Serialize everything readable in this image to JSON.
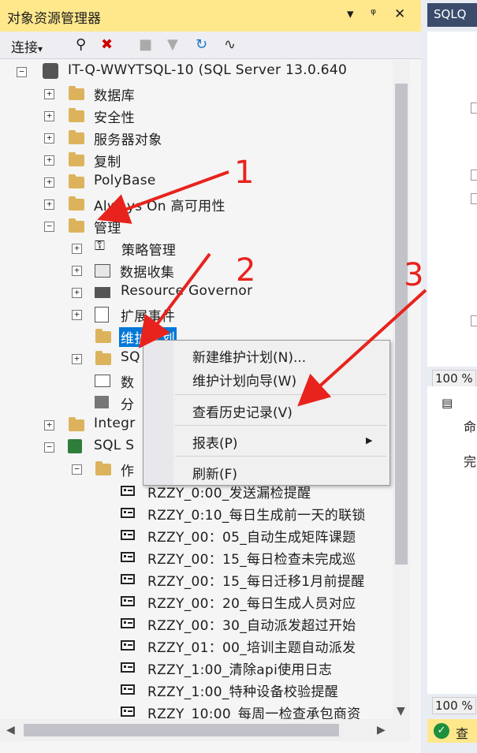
{
  "panel": {
    "title": "对象资源管理器",
    "pin": "▾",
    "dock": "⊓",
    "close": "✕"
  },
  "toolbar": {
    "connect_label": "连接",
    "connect_arrow": "▾"
  },
  "tree": {
    "server": "IT-Q-WWYTSQL-10 (SQL Server 13.0.640",
    "databases": "数据库",
    "security": "安全性",
    "server_objects": "服务器对象",
    "replication": "复制",
    "polybase": "PolyBase",
    "always_on": "Always On 高可用性",
    "management": "管理",
    "policy_mgmt": "策略管理",
    "data_collection": "数据收集",
    "resource_governor": "Resource Governor",
    "extended_events": "扩展事件",
    "maint_plans": "维护计划",
    "sql_logs": "SQ",
    "db_mail": "数",
    "dtc": "分",
    "integration": "Integr",
    "sql_agent": "SQL S",
    "jobs": "作",
    "job_items": [
      "RZZY_0:00_发送漏检提醒",
      "RZZY_0:10_每日生成前一天的联锁",
      "RZZY_00：05_自动生成矩阵课题",
      "RZZY_00：15_每日检查未完成巡",
      "RZZY_00：15_每日迁移1月前提醒",
      "RZZY_00：20_每日生成人员对应",
      "RZZY_00：30_自动派发超过开始",
      "RZZY_01：00_培训主题自动派发",
      "RZZY_1:00_清除api使用日志",
      "RZZY_1:00_特种设备校验提醒",
      "RZZY_10:00_每周一检查承包商资"
    ]
  },
  "context_menu": {
    "items": [
      "新建维护计划(N)...",
      "维护计划向导(W)",
      "查看历史记录(V)",
      "报表(P)",
      "刷新(F)"
    ],
    "submenu_arrow": "▶"
  },
  "right": {
    "tab": "SQLQ",
    "zoom_top": "100 %",
    "zoom_bottom": "100 %",
    "msg1": "命",
    "msg2": "完",
    "status": "查"
  },
  "annotations": [
    "1",
    "2",
    "3"
  ],
  "colors": {
    "title_bg": "#ffe88c",
    "selection": "#0078d7",
    "arrow": "#e8231d",
    "folder": "#dcb35c"
  }
}
